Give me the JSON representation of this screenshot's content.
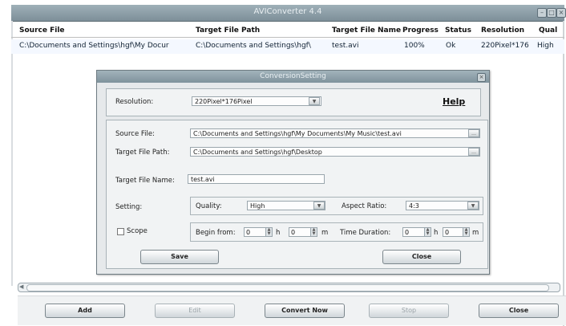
{
  "window": {
    "title": "AVIConverter 4.4"
  },
  "table": {
    "columns": [
      "Source File",
      "Target File Path",
      "Target File Name",
      "Progress",
      "Status",
      "Resolution",
      "Qual"
    ],
    "rows": [
      {
        "source": "C:\\Documents and Settings\\hgf\\My Docur",
        "target_path": "C:\\Documents and Settings\\hgf\\",
        "target_name": "test.avi",
        "progress": "100%",
        "status": "Ok",
        "resolution": "220Pixel*176",
        "quality": "High"
      }
    ]
  },
  "dialog": {
    "title": "ConversionSetting",
    "resolution_label": "Resolution:",
    "resolution_value": "220Pixel*176Pixel",
    "help_label": "Help",
    "source_label": "Source File:",
    "source_value": "C:\\Documents and Settings\\hgf\\My Documents\\My Music\\test.avi",
    "target_path_label": "Target File Path:",
    "target_path_value": "C:\\Documents and Settings\\hgf\\Desktop",
    "target_name_label": "Target File Name:",
    "target_name_value": "test.avi",
    "setting_label": "Setting:",
    "quality_label": "Quality:",
    "quality_value": "High",
    "aspect_label": "Aspect Ratio:",
    "aspect_value": "4:3",
    "scope_label": "Scope",
    "begin_label": "Begin from:",
    "begin_h": "0",
    "h_label": "h",
    "begin_m": "0",
    "m_label": "m",
    "duration_label": "Time Duration:",
    "dur_h": "0",
    "dur_m": "0",
    "save_label": "Save",
    "close_label": "Close"
  },
  "bottom": {
    "add": "Add",
    "edit": "Edit",
    "convert": "Convert Now",
    "stop": "Stop",
    "close": "Close"
  }
}
